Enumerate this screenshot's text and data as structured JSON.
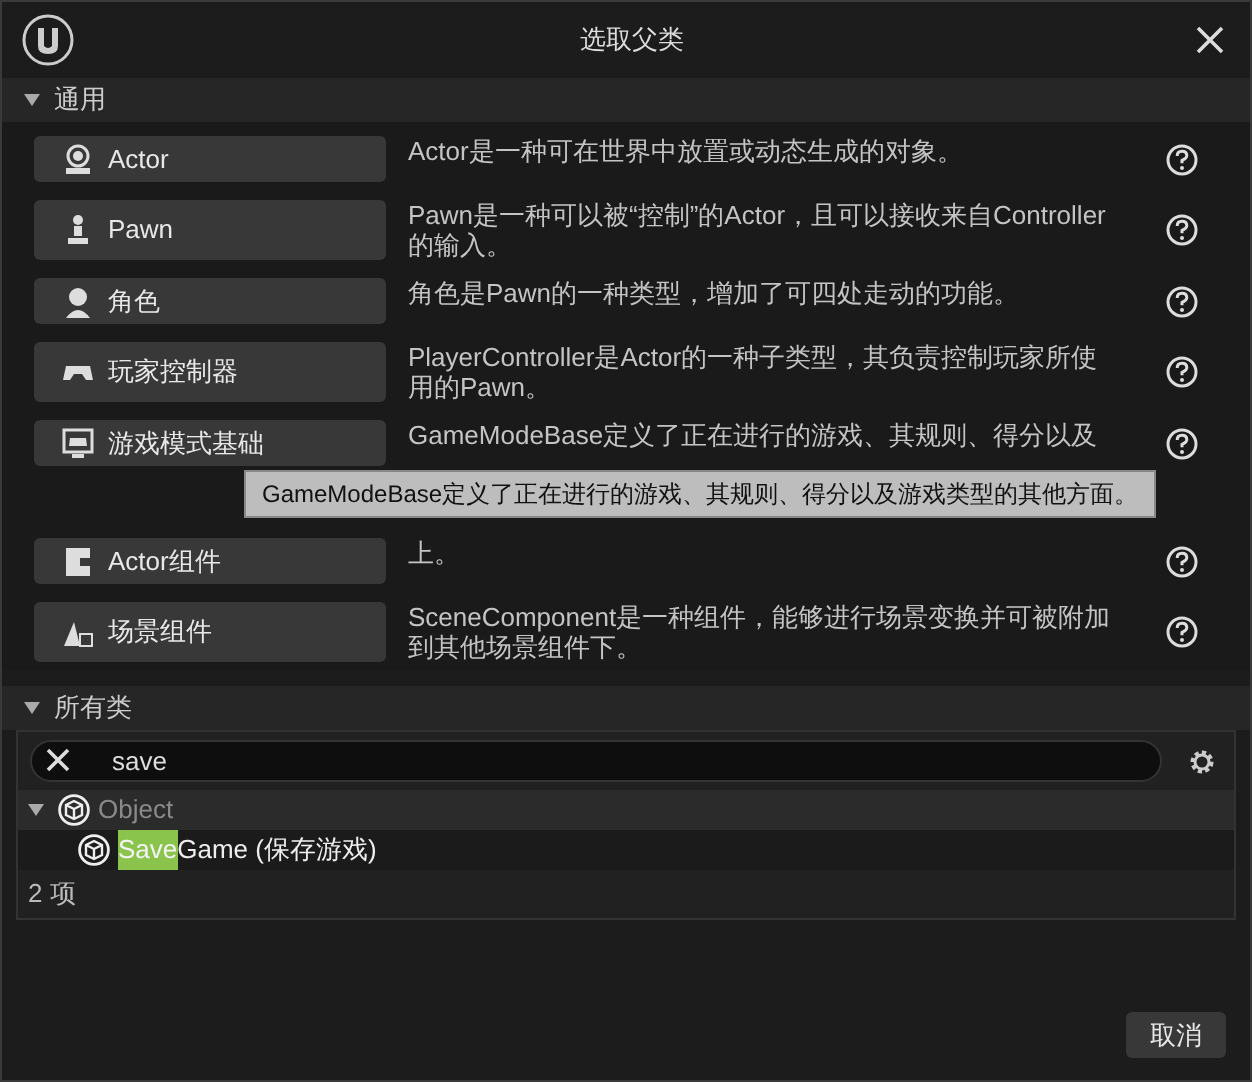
{
  "window": {
    "title": "选取父类"
  },
  "common": {
    "header": "通用",
    "expanded": true,
    "items": [
      {
        "kind": "actor",
        "label": "Actor",
        "description": "Actor是一种可在世界中放置或动态生成的对象。"
      },
      {
        "kind": "pawn",
        "label": "Pawn",
        "description": "Pawn是一种可以被“控制”的Actor，且可以接收来自Controller的输入。"
      },
      {
        "kind": "character",
        "label": "角色",
        "description": "角色是Pawn的一种类型，增加了可四处走动的功能。"
      },
      {
        "kind": "controller",
        "label": "玩家控制器",
        "description": "PlayerController是Actor的一种子类型，其负责控制玩家所使用的Pawn。"
      },
      {
        "kind": "gamemode",
        "label": "游戏模式基础",
        "description": "GameModeBase定义了正在进行的游戏、其规则、得分以及",
        "tooltip": "GameModeBase定义了正在进行的游戏、其规则、得分以及游戏类型的其他方面。"
      },
      {
        "kind": "component",
        "label": "Actor组件",
        "description": "上。"
      },
      {
        "kind": "scene",
        "label": "场景组件",
        "description": "SceneComponent是一种组件，能够进行场景变换并可被附加到其他场景组件下。"
      }
    ]
  },
  "all_classes": {
    "header": "所有类",
    "expanded": true,
    "search": {
      "value": "save"
    },
    "tree": [
      {
        "label": "Object",
        "dimmed": true,
        "expanded": true,
        "children": [
          {
            "match": "Save",
            "label": "Game (保存游戏)",
            "dimmed": false
          }
        ]
      }
    ],
    "count": "2 项"
  },
  "buttons": [
    "取消"
  ]
}
